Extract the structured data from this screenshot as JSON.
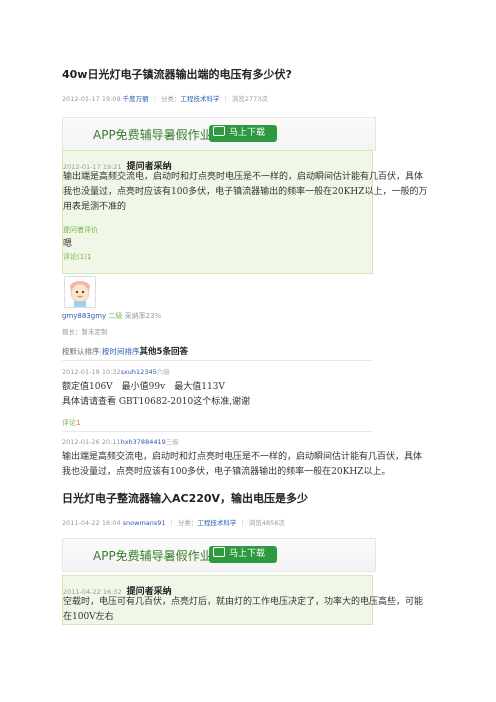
{
  "q1": {
    "title": "40w日光灯电子镇流器输出端的电压有多少伏?",
    "date": "2012-01-17 19:09",
    "user": "千度万丽",
    "category_label": "分类：",
    "category": "工程技术科学",
    "views": "浏览2773次"
  },
  "banner": {
    "text": "APP免费辅导暑假作业",
    "button": "马上下载"
  },
  "best1": {
    "date": "2012-01-17 19:21",
    "label": "提问者采纳",
    "lines": [
      "输出端是高频交流电，启动时和灯点亮时电压是不一样的，启动瞬间估计能有几百伏，具体",
      "我也没量过，点亮时应该有100多伏，电子镇流器输出的频率一般在20KHZ以上，一般的万",
      "用表是测不准的"
    ],
    "eval_label": "提问者评价",
    "eval": "嗯",
    "comment": "评论(1)",
    "comment_count": "1",
    "answerer": "gmy883gmy",
    "level": "二级",
    "rate": "采纳率23%",
    "expertise": "擅长：暂未定制"
  },
  "sort": {
    "prefix": "按默认排序",
    "sep": "|",
    "by_time": "按时间排序",
    "other": "其他5条回答"
  },
  "ans1": {
    "date": "2012-01-18 10:32",
    "user": "sxuh12345",
    "level": "六级",
    "lines": [
      "额定值106V　最小值99v　最大值113V",
      "具体请请查看 GBT10682-2010这个标准,谢谢"
    ],
    "comment": "评论",
    "comment_count": "1"
  },
  "ans2": {
    "date": "2012-01-26 20:11",
    "user": "hxh37884419",
    "level": "三级",
    "lines": [
      "输出端是高频交流电，启动时和灯点亮时电压是不一样的，启动瞬间估计能有几百伏，具体",
      "我也没量过，点亮时应该有100多伏，电子镇流器输出的频率一般在20KHZ以上。"
    ]
  },
  "q2": {
    "title": "日光灯电子整流器输入AC220V，输出电压是多少",
    "date": "2011-04-22 16:04",
    "user": "snowmans91",
    "category_label": "分类：",
    "category": "工程技术科学",
    "views": "浏览4858次"
  },
  "best2": {
    "date": "2011-04-22 16:32",
    "label": "提问者采纳",
    "lines": [
      "空载时，电压可有几百伏，点亮灯后，就由灯的工作电压决定了，功率大的电压高些，可能",
      "在100V左右"
    ]
  }
}
